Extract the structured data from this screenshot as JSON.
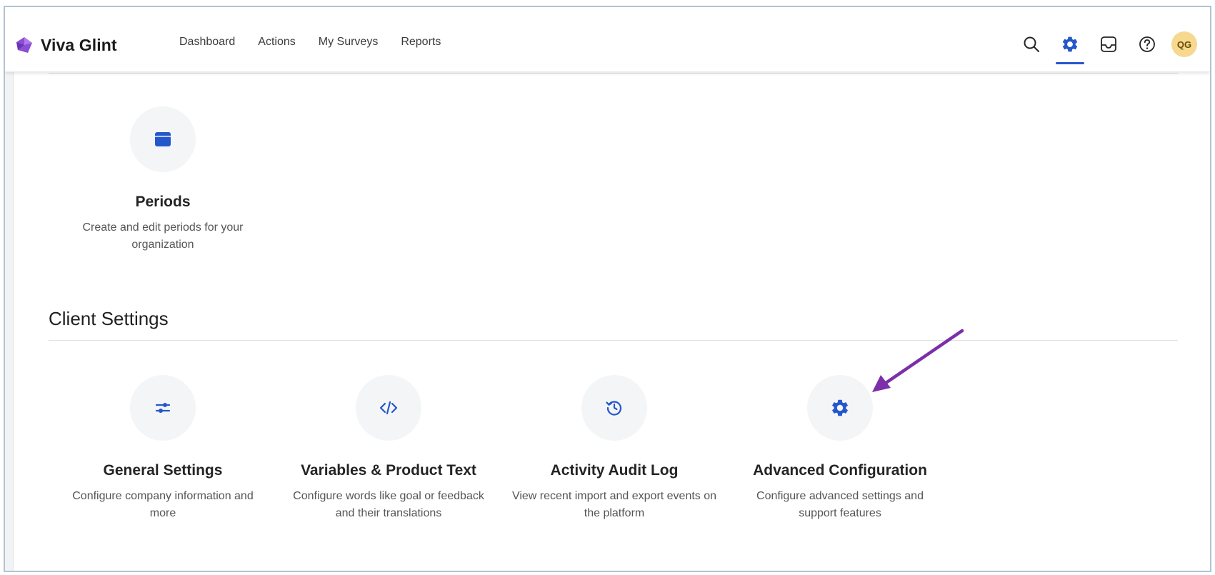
{
  "brand": {
    "name": "Viva Glint",
    "logo_icon": "viva-glint-logo",
    "logo_color": "#8a4fd6"
  },
  "nav": {
    "items": [
      {
        "label": "Dashboard"
      },
      {
        "label": "Actions"
      },
      {
        "label": "My Surveys"
      },
      {
        "label": "Reports"
      }
    ]
  },
  "toolbar": {
    "search_icon": "search-icon",
    "settings_icon": "gear-icon",
    "settings_active": true,
    "inbox_icon": "inbox-icon",
    "help_icon": "help-icon",
    "avatar_initials": "QG",
    "accent_color": "#2557cc"
  },
  "periods_card": {
    "icon": "calendar-icon",
    "title": "Periods",
    "description": "Create and edit periods for your organization"
  },
  "client_settings": {
    "title": "Client Settings",
    "cards": [
      {
        "icon": "sliders-icon",
        "title": "General Settings",
        "description": "Configure company information and more"
      },
      {
        "icon": "code-icon",
        "title": "Variables & Product Text",
        "description": "Configure words like goal or feedback and their translations"
      },
      {
        "icon": "history-icon",
        "title": "Activity Audit Log",
        "description": "View recent import and export events on the platform"
      },
      {
        "icon": "gear-icon",
        "title": "Advanced Configuration",
        "description": "Configure advanced settings and support features"
      }
    ]
  },
  "annotation": {
    "icon": "arrow-annotation",
    "color": "#7b2fa8"
  }
}
